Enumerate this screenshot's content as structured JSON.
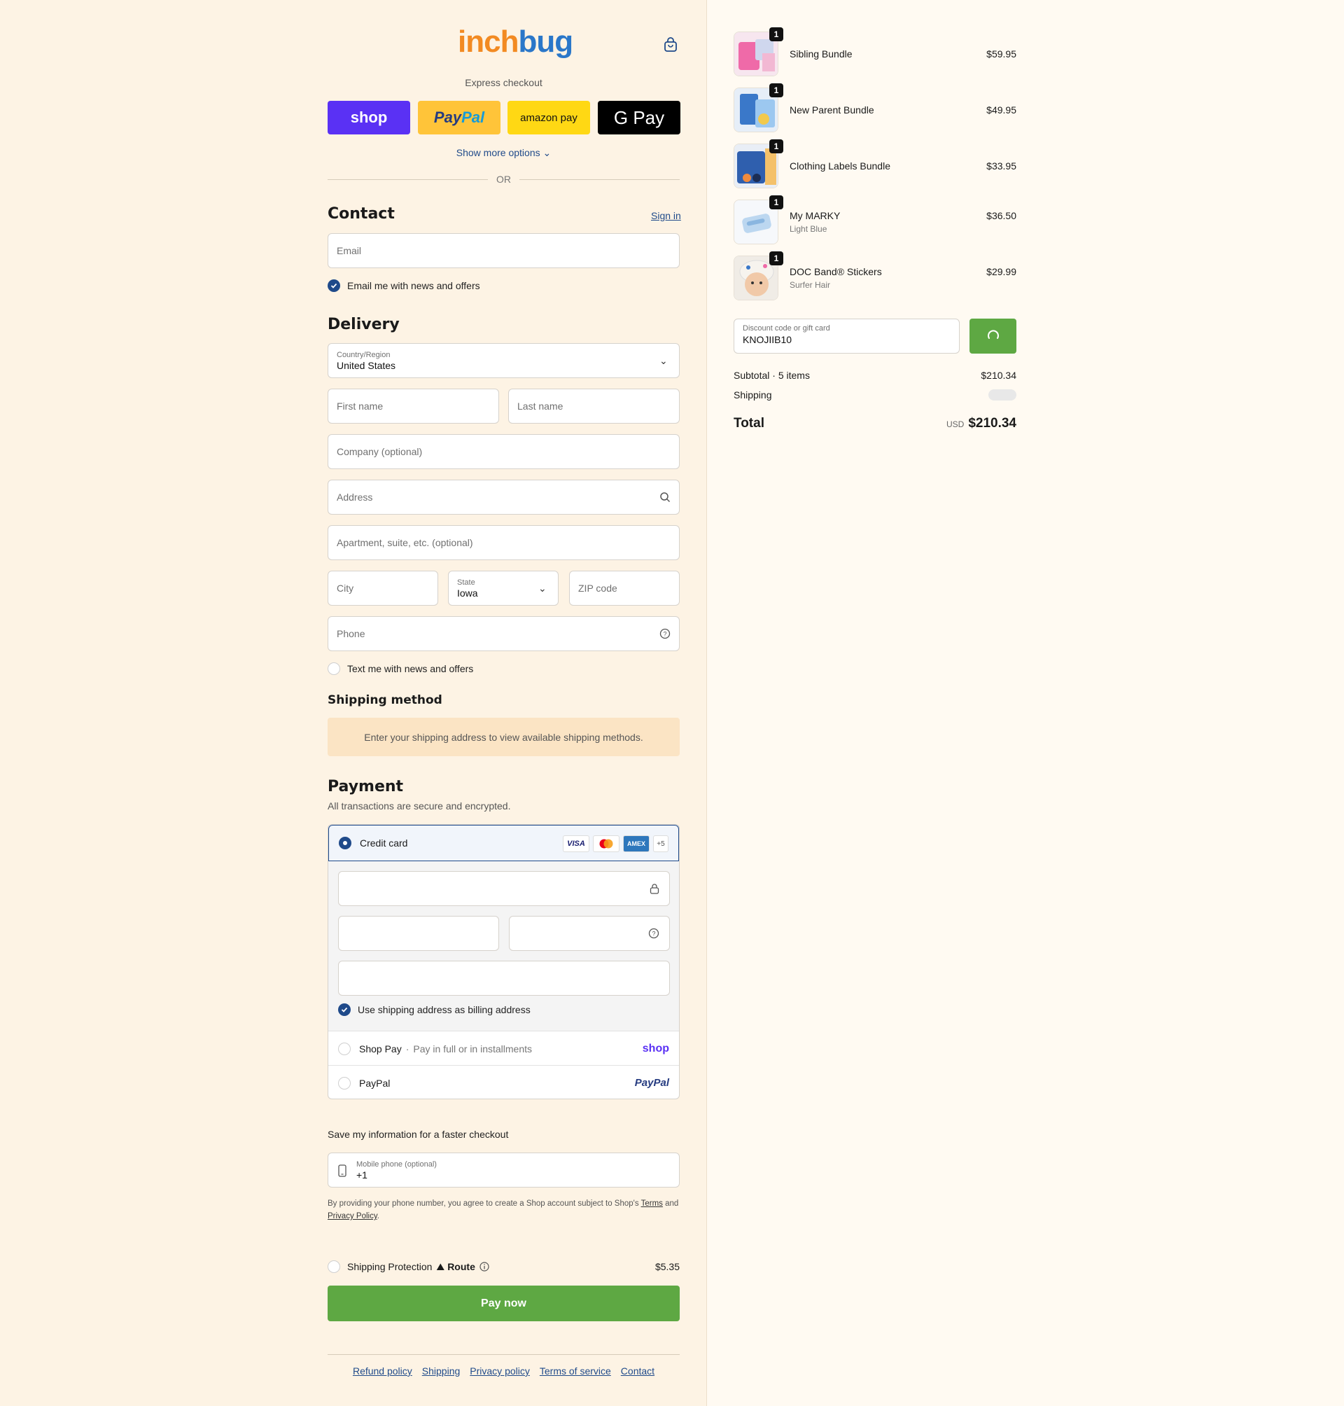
{
  "brand": {
    "logo_a": "inch",
    "logo_b": "bug"
  },
  "express": {
    "label": "Express checkout",
    "shop": "shop",
    "paypal_a": "Pay",
    "paypal_b": "Pal",
    "amazon": "amazon pay",
    "gpay": "G Pay",
    "show_more": "Show more options"
  },
  "or_label": "OR",
  "contact": {
    "title": "Contact",
    "sign_in": "Sign in",
    "email_placeholder": "Email",
    "news_label": "Email me with news and offers"
  },
  "delivery": {
    "title": "Delivery",
    "country_label": "Country/Region",
    "country_value": "United States",
    "first_name": "First name",
    "last_name": "Last name",
    "company": "Company (optional)",
    "address": "Address",
    "apartment": "Apartment, suite, etc. (optional)",
    "city": "City",
    "state_label": "State",
    "state_value": "Iowa",
    "zip": "ZIP code",
    "phone": "Phone",
    "text_label": "Text me with news and offers"
  },
  "shipping_method": {
    "title": "Shipping method",
    "message": "Enter your shipping address to view available shipping methods."
  },
  "payment": {
    "title": "Payment",
    "subtitle": "All transactions are secure and encrypted.",
    "credit_card": "Credit card",
    "card_logos": [
      "VISA",
      "MC",
      "AMEX",
      "+5"
    ],
    "billing_label": "Use shipping address as billing address",
    "shop_pay": "Shop Pay",
    "shop_pay_sub": "Pay in full or in installments",
    "shop_pay_brand": "shop",
    "paypal": "PayPal",
    "paypal_brand": "PayPal"
  },
  "save_info": {
    "title": "Save my information for a faster checkout",
    "mobile_label": "Mobile phone (optional)",
    "mobile_value": "+1",
    "fine_print_1": "By providing your phone number, you agree to create a Shop account subject to Shop's",
    "terms": "Terms",
    "and": "and",
    "privacy": "Privacy Policy",
    "period": "."
  },
  "protection": {
    "label": "Shipping Protection",
    "brand": "Route",
    "price": "$5.35"
  },
  "pay_now": "Pay now",
  "footer_links": [
    "Refund policy",
    "Shipping",
    "Privacy policy",
    "Terms of service",
    "Contact"
  ],
  "cart": {
    "items": [
      {
        "name": "Sibling Bundle",
        "variant": "",
        "price": "$59.95",
        "qty": "1"
      },
      {
        "name": "New Parent Bundle",
        "variant": "",
        "price": "$49.95",
        "qty": "1"
      },
      {
        "name": "Clothing Labels Bundle",
        "variant": "",
        "price": "$33.95",
        "qty": "1"
      },
      {
        "name": "My MARKY",
        "variant": "Light Blue",
        "price": "$36.50",
        "qty": "1"
      },
      {
        "name": "DOC Band® Stickers",
        "variant": "Surfer Hair",
        "price": "$29.99",
        "qty": "1"
      }
    ],
    "discount_label": "Discount code or gift card",
    "discount_value": "KNOJIIB10",
    "subtotal_label": "Subtotal · 5 items",
    "subtotal_value": "$210.34",
    "shipping_label": "Shipping",
    "total_label": "Total",
    "currency": "USD",
    "total_value": "$210.34"
  },
  "colors": {
    "accent": "#1f4a8a",
    "pay_button": "#5ea843",
    "shop_purple": "#5a31f4"
  }
}
